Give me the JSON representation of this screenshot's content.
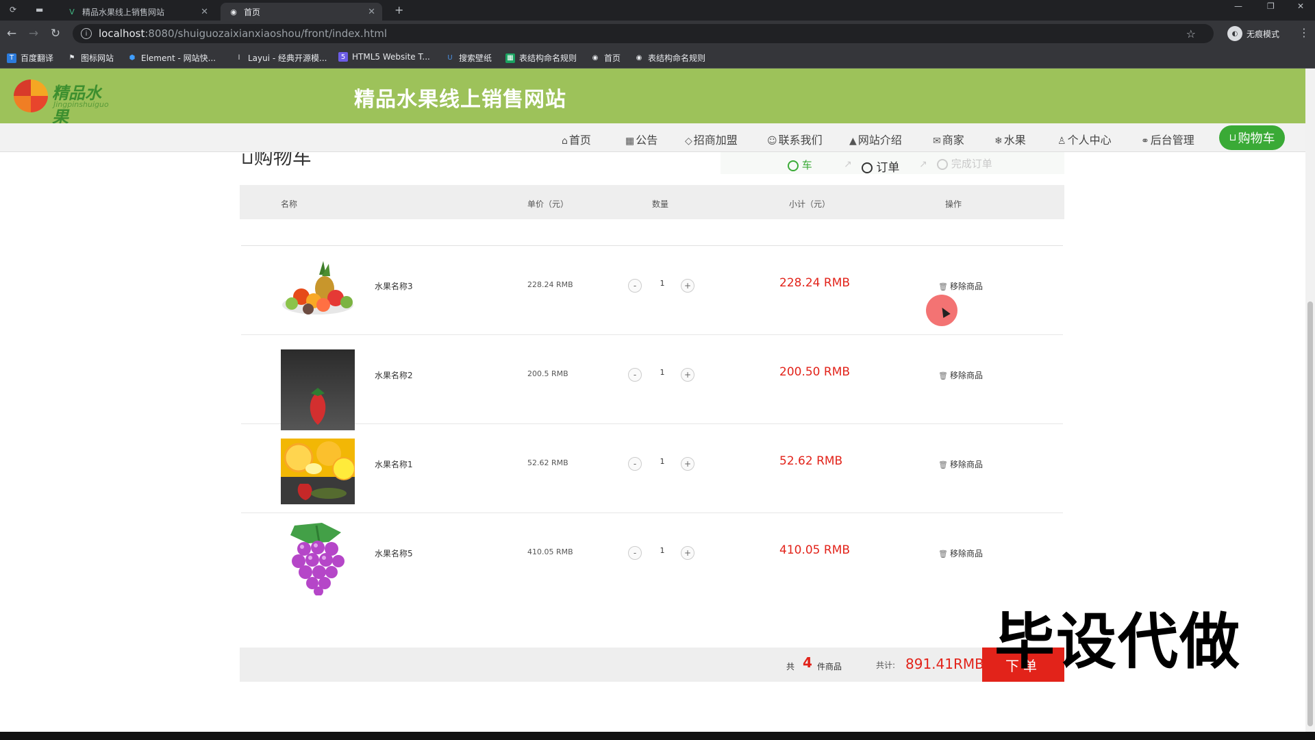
{
  "browser": {
    "tabs": [
      {
        "title": "精品水果线上销售网站",
        "active": false
      },
      {
        "title": "首页",
        "active": true
      }
    ],
    "new_tab": "+",
    "url_host": "localhost",
    "url_path": ":8080/shuiguozaixianxiaoshou/front/index.html",
    "incognito_label": "无痕模式",
    "bookmarks": [
      "百度翻译",
      "图标网站",
      "Element - 网站快...",
      "Layui - 经典开源模...",
      "HTML5 Website T...",
      "搜索壁纸",
      "表结构命名规则",
      "首页",
      "表结构命名规则"
    ]
  },
  "site": {
    "logo_text": "精品水果",
    "logo_sub": "Jingpinshuiguo",
    "title": "精品水果线上销售网站"
  },
  "nav": {
    "items": [
      "首页",
      "公告",
      "招商加盟",
      "联系我们",
      "网站介绍",
      "商家",
      "水果",
      "个人中心",
      "后台管理"
    ],
    "cart": "购物车"
  },
  "cart": {
    "heading": "购物车",
    "steps": [
      "车",
      "订单",
      "完成订单"
    ],
    "columns": {
      "name": "名称",
      "price": "单价（元）",
      "qty": "数量",
      "subtotal": "小计（元）",
      "action": "操作"
    },
    "items": [
      {
        "name": "水果名称3",
        "price": "228.24 RMB",
        "qty": "1",
        "subtotal": "228.24 RMB",
        "remove": "移除商品"
      },
      {
        "name": "水果名称2",
        "price": "200.5 RMB",
        "qty": "1",
        "subtotal": "200.50 RMB",
        "remove": "移除商品"
      },
      {
        "name": "水果名称1",
        "price": "52.62 RMB",
        "qty": "1",
        "subtotal": "52.62 RMB",
        "remove": "移除商品"
      },
      {
        "name": "水果名称5",
        "price": "410.05 RMB",
        "qty": "1",
        "subtotal": "410.05 RMB",
        "remove": "移除商品"
      }
    ],
    "minus": "-",
    "plus": "+",
    "footer": {
      "prefix": "共",
      "count": "4",
      "unit": "件商品",
      "sum_label": "共计:",
      "sum": "891.41RMB",
      "order_button": "下单"
    }
  },
  "watermark": "毕设代做"
}
